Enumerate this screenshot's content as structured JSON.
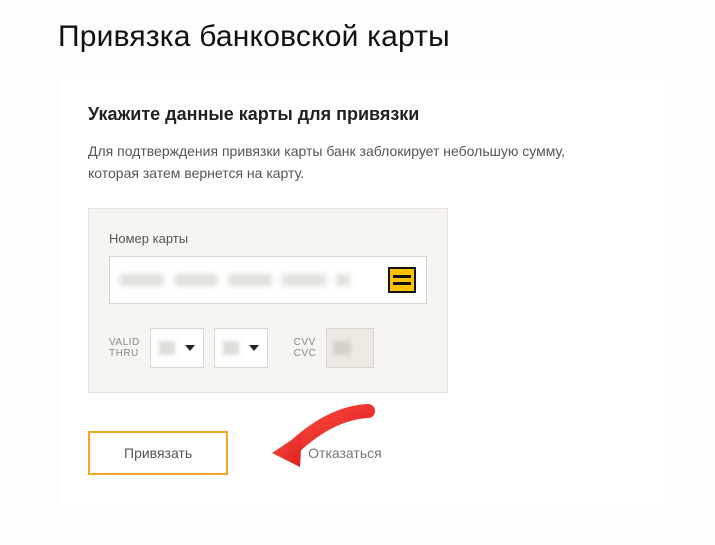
{
  "page_title": "Привязка банковской карты",
  "panel": {
    "title": "Укажите данные карты для привязки",
    "desc": "Для подтверждения привязки карты банк заблокирует небольшую сумму, которая затем вернется на карту."
  },
  "card": {
    "number_label": "Номер карты",
    "valid_line1": "VALID",
    "valid_line2": "THRU",
    "cvv_line1": "CVV",
    "cvv_line2": "CVC"
  },
  "actions": {
    "submit": "Привязать",
    "cancel": "Отказаться"
  }
}
